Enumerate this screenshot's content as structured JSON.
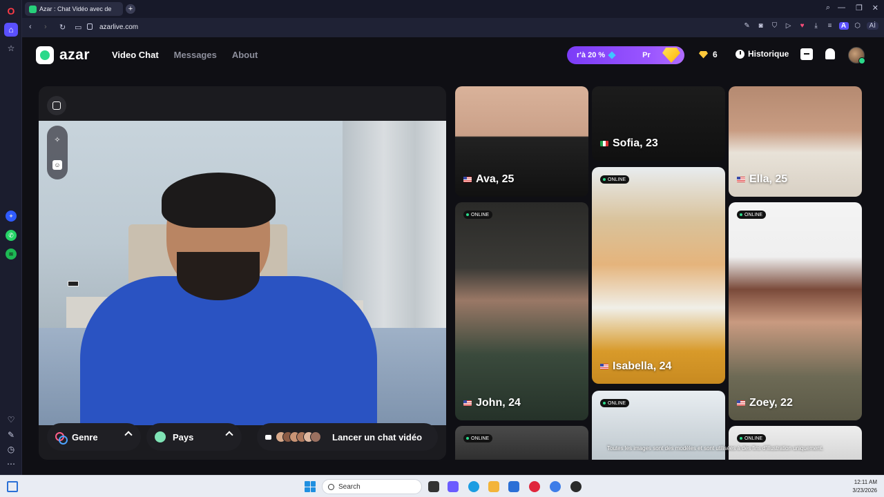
{
  "browser": {
    "tab_title": "Azar : Chat Vidéo avec de",
    "new_tab": "+",
    "url": "azarlive.com",
    "ai_label": "Aİ",
    "profile_letter": "A"
  },
  "header": {
    "logo_text": "azar",
    "nav": [
      "Video Chat",
      "Messages",
      "About"
    ],
    "promo_text": "r'à 20 %",
    "promo_suffix": "Pr",
    "gem_count": "6",
    "history_label": "Historique"
  },
  "controls": {
    "gender_label": "Genre",
    "country_label": "Pays",
    "start_label": "Lancer un chat vidéo"
  },
  "profiles": [
    {
      "name": "Ava, 25",
      "flag": "us",
      "online": false
    },
    {
      "name": "Sofia, 23",
      "flag": "it",
      "online": false
    },
    {
      "name": "Ella, 25",
      "flag": "us",
      "online": false
    },
    {
      "name": "Isabella, 24",
      "flag": "us",
      "online": true
    },
    {
      "name": "John, 24",
      "flag": "us",
      "online": true
    },
    {
      "name": "Zoey, 22",
      "flag": "us",
      "online": true
    },
    {
      "name": "",
      "flag": "",
      "online": true
    },
    {
      "name": "",
      "flag": "",
      "online": true
    },
    {
      "name": "",
      "flag": "",
      "online": true
    }
  ],
  "online_label": "ONLINE",
  "disclaimer": "Toutes les images sont des modèles et sont utilisées à des fins d'illustration uniquement.",
  "taskbar": {
    "search_placeholder": "Search",
    "time": "12:11 AM",
    "date": "3/23/2026"
  },
  "colors": {
    "accent_green": "#2bd98a",
    "promo_purple": "#8b47fb",
    "background": "#0f0f14"
  }
}
